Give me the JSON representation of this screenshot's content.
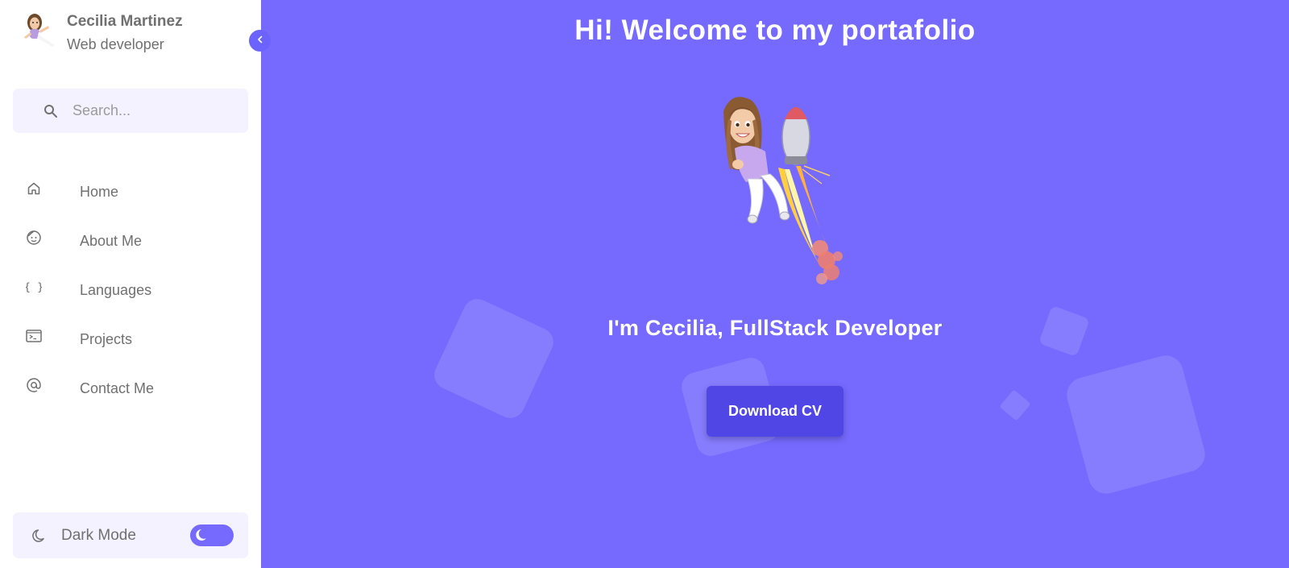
{
  "profile": {
    "name": "Cecilia Martinez",
    "role": "Web developer"
  },
  "search": {
    "placeholder": "Search..."
  },
  "nav": {
    "items": [
      {
        "label": "Home",
        "icon": "home-icon"
      },
      {
        "label": "About Me",
        "icon": "smiley-icon"
      },
      {
        "label": "Languages",
        "icon": "braces-icon"
      },
      {
        "label": "Projects",
        "icon": "terminal-icon"
      },
      {
        "label": "Contact Me",
        "icon": "at-icon"
      }
    ]
  },
  "darkmode": {
    "label": "Dark Mode",
    "enabled": false
  },
  "main": {
    "title": "Hi! Welcome to my portafolio",
    "subtitle": "I'm Cecilia, FullStack Developer",
    "cv_button": "Download CV"
  },
  "colors": {
    "accent": "#7569fe",
    "button": "#4f46e5",
    "sidebar_bg": "#ffffff",
    "panel_bg": "#f4f2ff",
    "text": "#707070"
  }
}
